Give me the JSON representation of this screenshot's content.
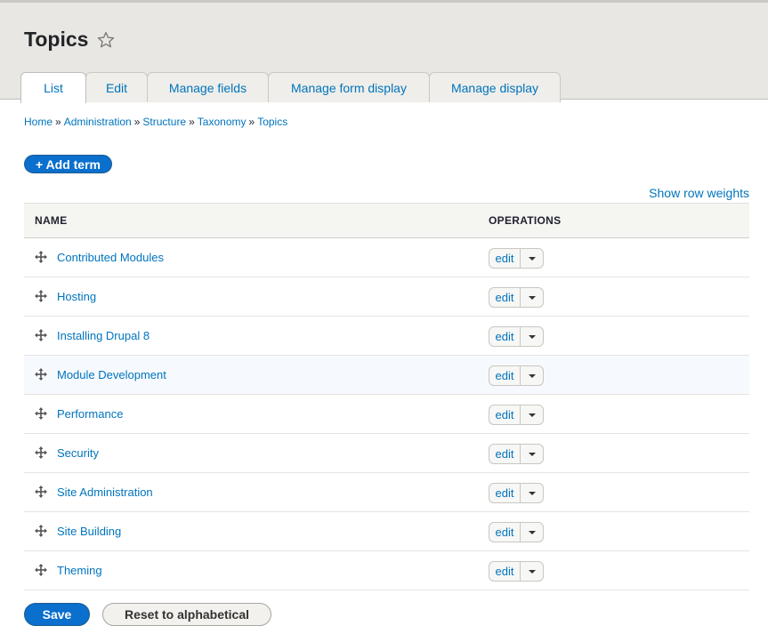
{
  "page": {
    "title": "Topics"
  },
  "tabs": [
    {
      "label": "List",
      "active": true
    },
    {
      "label": "Edit"
    },
    {
      "label": "Manage fields"
    },
    {
      "label": "Manage form display"
    },
    {
      "label": "Manage display"
    }
  ],
  "breadcrumb": {
    "items": [
      "Home",
      "Administration",
      "Structure",
      "Taxonomy",
      "Topics"
    ],
    "separator": "»"
  },
  "actions": {
    "add_term": "+ Add term",
    "show_row_weights": "Show row weights"
  },
  "table": {
    "headers": {
      "name": "NAME",
      "operations": "OPERATIONS"
    },
    "rows": [
      {
        "name": "Contributed Modules",
        "op": "edit"
      },
      {
        "name": "Hosting",
        "op": "edit"
      },
      {
        "name": "Installing Drupal 8",
        "op": "edit"
      },
      {
        "name": "Module Development",
        "op": "edit"
      },
      {
        "name": "Performance",
        "op": "edit"
      },
      {
        "name": "Security",
        "op": "edit"
      },
      {
        "name": "Site Administration",
        "op": "edit"
      },
      {
        "name": "Site Building",
        "op": "edit"
      },
      {
        "name": "Theming",
        "op": "edit"
      }
    ]
  },
  "footer": {
    "save": "Save",
    "reset": "Reset to alphabetical"
  },
  "icons": {
    "favorite": "star-outline-icon",
    "drag": "drag-handle-icon",
    "dropdown": "caret-down-icon"
  },
  "colors": {
    "link": "#0074bd",
    "primary_button": "#0a6fcd",
    "header_bg": "#e8e7e3"
  }
}
